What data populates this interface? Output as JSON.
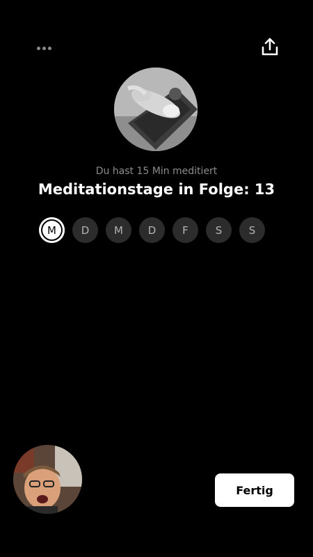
{
  "header": {
    "more_icon": "more-horizontal-icon",
    "share_icon": "share-upload-icon"
  },
  "summary": {
    "subtitle": "Du hast 15 Min meditiert",
    "title": "Meditationstage in Folge: 13"
  },
  "week": {
    "days": [
      "M",
      "D",
      "M",
      "D",
      "F",
      "S",
      "S"
    ],
    "active_index": 0
  },
  "footer": {
    "done_label": "Fertig"
  },
  "colors": {
    "background": "#000000",
    "day_inactive": "#2c2c2c",
    "muted_text": "#8c8c8c",
    "button_bg": "#ffffff"
  }
}
